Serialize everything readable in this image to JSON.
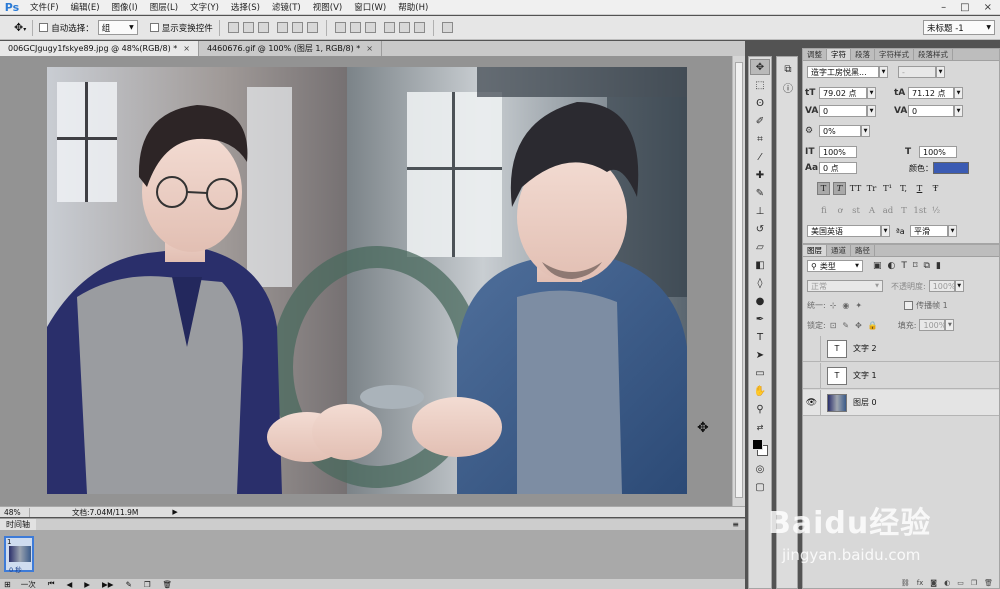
{
  "app": {
    "logo": "Ps"
  },
  "menu": [
    "文件(F)",
    "编辑(E)",
    "图像(I)",
    "图层(L)",
    "文字(Y)",
    "选择(S)",
    "滤镜(T)",
    "视图(V)",
    "窗口(W)",
    "帮助(H)"
  ],
  "window_controls": [
    "–",
    "□",
    "×"
  ],
  "options_bar": {
    "auto_select_label": "自动选择：",
    "auto_select_value": "组",
    "transform_controls_label": "显示变换控件",
    "workspace_value": "未标题 -1"
  },
  "tabs": [
    {
      "label": "006GCJgugy1fskye89.jpg @ 48%(RGB/8) *",
      "close": "×"
    },
    {
      "label": "4460676.gif @ 100% (图层 1, RGB/8) *",
      "close": "×"
    }
  ],
  "status": {
    "zoom": "48%",
    "doc": "文档:7.04M/11.9M"
  },
  "timeline": {
    "title": "时间轴",
    "frame_number": "1",
    "frame_delay": "0 秒",
    "loop": "一次"
  },
  "character_panel": {
    "tabs": [
      "调整",
      "字符",
      "段落",
      "字符样式",
      "段落样式"
    ],
    "font_family": "造字工房悦黑...",
    "font_style": "-",
    "font_size": "79.02 点",
    "leading": "71.12 点",
    "kerning": "0",
    "tracking": "0",
    "tsume": "0%",
    "vertical_scale": "100%",
    "horizontal_scale": "100%",
    "baseline_shift": "0 点",
    "color_label": "颜色：",
    "color_value": "#3b5bb3",
    "type_styles": [
      "T",
      "T",
      "TT",
      "Tr",
      "T¹",
      "T,",
      "T",
      "Ŧ"
    ],
    "opentype": [
      "fi",
      "ơ",
      "st",
      "A",
      "ad",
      "T",
      "1st",
      "½"
    ],
    "language": "美国英语",
    "aa_label": "ªa",
    "antialias": "平滑"
  },
  "layers_panel": {
    "tabs": [
      "图层",
      "通道",
      "路径"
    ],
    "filter_kind": "类型",
    "blend_mode": "正常",
    "opacity_label": "不透明度:",
    "opacity_value": "100%",
    "unify_label": "统一:",
    "propagate_label": "传播帧 1",
    "lock_label": "锁定:",
    "fill_label": "填充:",
    "fill_value": "100%",
    "layers": [
      {
        "name": "文字 2",
        "visible": false,
        "kind": "text"
      },
      {
        "name": "文字 1",
        "visible": false,
        "kind": "text"
      },
      {
        "name": "图层 0",
        "visible": true,
        "kind": "image"
      }
    ]
  },
  "watermark": {
    "brand": "Baidu经验",
    "url": "jingyan.baidu.com"
  }
}
